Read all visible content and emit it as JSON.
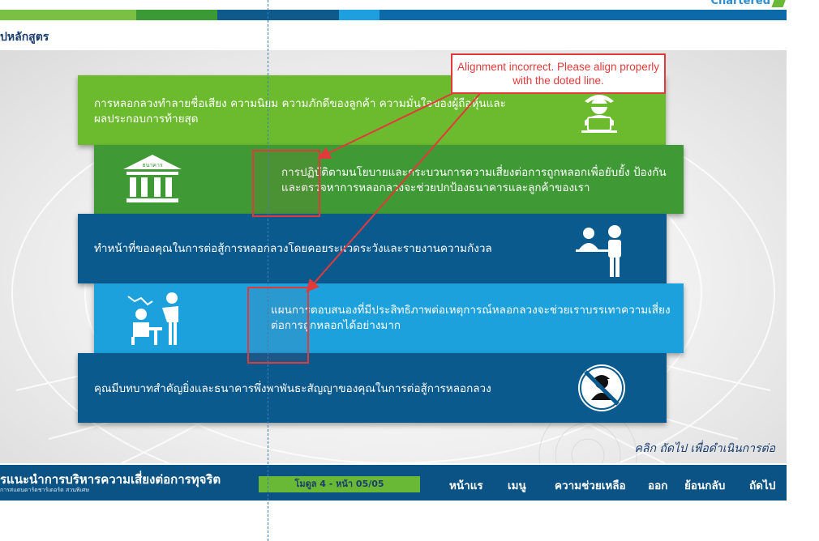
{
  "header": {
    "brand": "Chartered",
    "breadcrumb": "ุปหลักสูตร",
    "colors": [
      "#7ac143",
      "#3b9a35",
      "#0f5a8c",
      "#15619a",
      "#1ea0e0",
      "#0d6aa8"
    ]
  },
  "bands": [
    {
      "text": "การหลอกลวงทำลายชื่อเสียง ความนิยม ความภักดีของลูกค้า ความมั่นใจของผู้ถือหุ้นและผลประกอบการท้ายสุด",
      "icon": "masked-thief-laptop-icon",
      "color": "#6cbb2f"
    },
    {
      "text": "การปฏิบัติตามนโยบายและกระบวนการความเสี่ยงต่อการถูกหลอกเพื่อยับยั้ง ป้องกันและตรวจหาการหลอกลวงจะช่วยปกป้องธนาคารและลูกค้าของเรา",
      "icon": "bank-building-icon",
      "icon_label": "ธนาคาร",
      "color": "#3f9a35"
    },
    {
      "text": "ทำหน้าที่ของคุณในการต่อสู้การหลอกลวงโดยคอยระแวดระวังและรายงานความกังวล",
      "icon": "customer-service-desk-icon",
      "color": "#0b5a8e"
    },
    {
      "text": "แผนการตอบสนองที่มีประสิทธิภาพต่อเหตุการณ์หลอกลวงจะช่วยเราบรรเทาความเสี่ยงต่อการถูกหลอกได้อย่างมาก",
      "icon": "presentation-meeting-icon",
      "color": "#1ca1dd"
    },
    {
      "text": "คุณมีบทบาทสำคัญยิ่งและธนาคารพึ่งพาพันธะสัญญาของคุณในการต่อสู้การหลอกลวง",
      "icon": "no-fraudster-icon",
      "color": "#0b5a8e"
    }
  ],
  "annotation": {
    "note": "Alignment incorrect. Please align properly with the doted line."
  },
  "hint": "คลิก ถัดไป เพื่อดำเนินการต่อ",
  "footer": {
    "title": "รแนะนำการบริหารความเสี่ยงต่อการทุจริต",
    "subtitle": "การสแตนดาร์ดชาร์เตอร์ด สวนพิเศษ",
    "page_indicator": "โมดูล 4 - หน้า 05/05",
    "nav": [
      "หน้าแร",
      "เมนู",
      "ความช่วยเหลือ",
      "ออก",
      "ย้อนกลับ",
      "ถัดไป"
    ]
  }
}
